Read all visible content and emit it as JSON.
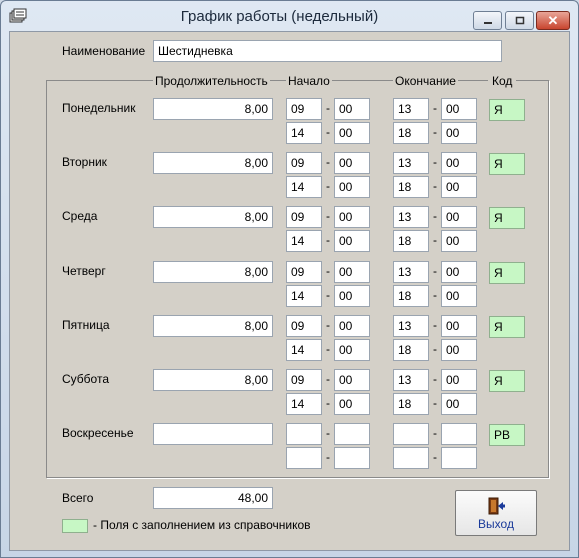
{
  "window": {
    "title": "График работы (недельный)",
    "close_glyph": "✕"
  },
  "form": {
    "name_label": "Наименование",
    "name_value": "Шестидневка",
    "headers": {
      "duration": "Продолжительность",
      "start": "Начало",
      "end": "Окончание",
      "code": "Код"
    },
    "days": [
      {
        "label": "Понедельник",
        "duration": "8,00",
        "rows": [
          [
            "09",
            "00",
            "13",
            "00"
          ],
          [
            "14",
            "00",
            "18",
            "00"
          ]
        ],
        "code": "Я"
      },
      {
        "label": "Вторник",
        "duration": "8,00",
        "rows": [
          [
            "09",
            "00",
            "13",
            "00"
          ],
          [
            "14",
            "00",
            "18",
            "00"
          ]
        ],
        "code": "Я"
      },
      {
        "label": "Среда",
        "duration": "8,00",
        "rows": [
          [
            "09",
            "00",
            "13",
            "00"
          ],
          [
            "14",
            "00",
            "18",
            "00"
          ]
        ],
        "code": "Я"
      },
      {
        "label": "Четверг",
        "duration": "8,00",
        "rows": [
          [
            "09",
            "00",
            "13",
            "00"
          ],
          [
            "14",
            "00",
            "18",
            "00"
          ]
        ],
        "code": "Я"
      },
      {
        "label": "Пятница",
        "duration": "8,00",
        "rows": [
          [
            "09",
            "00",
            "13",
            "00"
          ],
          [
            "14",
            "00",
            "18",
            "00"
          ]
        ],
        "code": "Я"
      },
      {
        "label": "Суббота",
        "duration": "8,00",
        "rows": [
          [
            "09",
            "00",
            "13",
            "00"
          ],
          [
            "14",
            "00",
            "18",
            "00"
          ]
        ],
        "code": "Я"
      },
      {
        "label": "Воскресенье",
        "duration": "",
        "rows": [
          [
            "",
            "",
            "",
            ""
          ],
          [
            "",
            "",
            "",
            ""
          ]
        ],
        "code": "РВ"
      }
    ],
    "total_label": "Всего",
    "total_value": "48,00",
    "legend_text": "- Поля с заполнением из справочников",
    "exit_label": "Выход"
  },
  "colors": {
    "lookup_field": "#c7f7c5",
    "client_bg": "#d4d0c8"
  },
  "icons": [
    "app-icon",
    "minimize-icon",
    "maximize-icon",
    "close-icon",
    "exit-door-icon"
  ]
}
